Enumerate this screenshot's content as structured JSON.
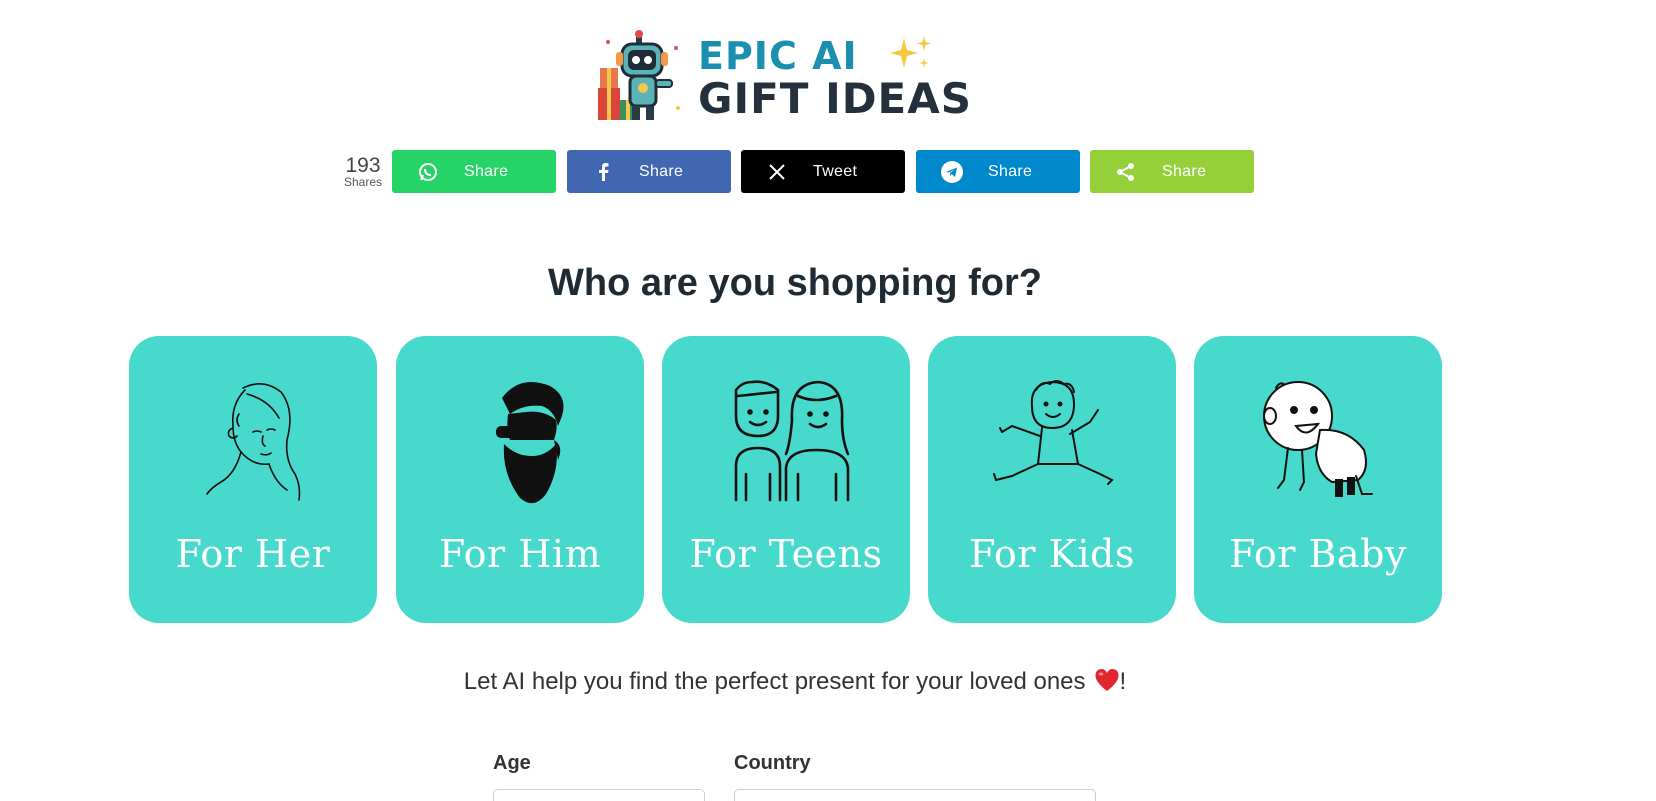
{
  "logo": {
    "line1": "EPIC AI",
    "line2": "GIFT IDEAS",
    "brand_colors": {
      "line1": "#1a8fb0",
      "line2": "#24313d"
    }
  },
  "share_bar": {
    "count": "193",
    "count_label": "Shares",
    "buttons": [
      {
        "network": "whatsapp",
        "icon": "whatsapp-icon",
        "label": "Share",
        "color": "#25d366"
      },
      {
        "network": "facebook",
        "icon": "facebook-icon",
        "label": "Share",
        "color": "#4267b2"
      },
      {
        "network": "x",
        "icon": "x-icon",
        "label": "Tweet",
        "color": "#000000"
      },
      {
        "network": "telegram",
        "icon": "telegram-icon",
        "label": "Share",
        "color": "#0088cc"
      },
      {
        "network": "sharethis",
        "icon": "share-icon",
        "label": "Share",
        "color": "#95d03a"
      }
    ]
  },
  "heading": "Who are you shopping for?",
  "categories": [
    {
      "label": "For Her",
      "icon": "woman-line-art-icon"
    },
    {
      "label": "For Him",
      "icon": "bearded-man-sunglasses-icon"
    },
    {
      "label": "For Teens",
      "icon": "teens-pair-icon"
    },
    {
      "label": "For Kids",
      "icon": "jumping-kid-icon"
    },
    {
      "label": "For Baby",
      "icon": "crawling-baby-icon"
    }
  ],
  "card_color": "#47d9cb",
  "tagline": {
    "text": "Let AI help you find the perfect present for your loved ones",
    "suffix": "!",
    "emoji_icon": "heart-icon"
  },
  "form": {
    "age_label": "Age",
    "country_label": "Country"
  }
}
